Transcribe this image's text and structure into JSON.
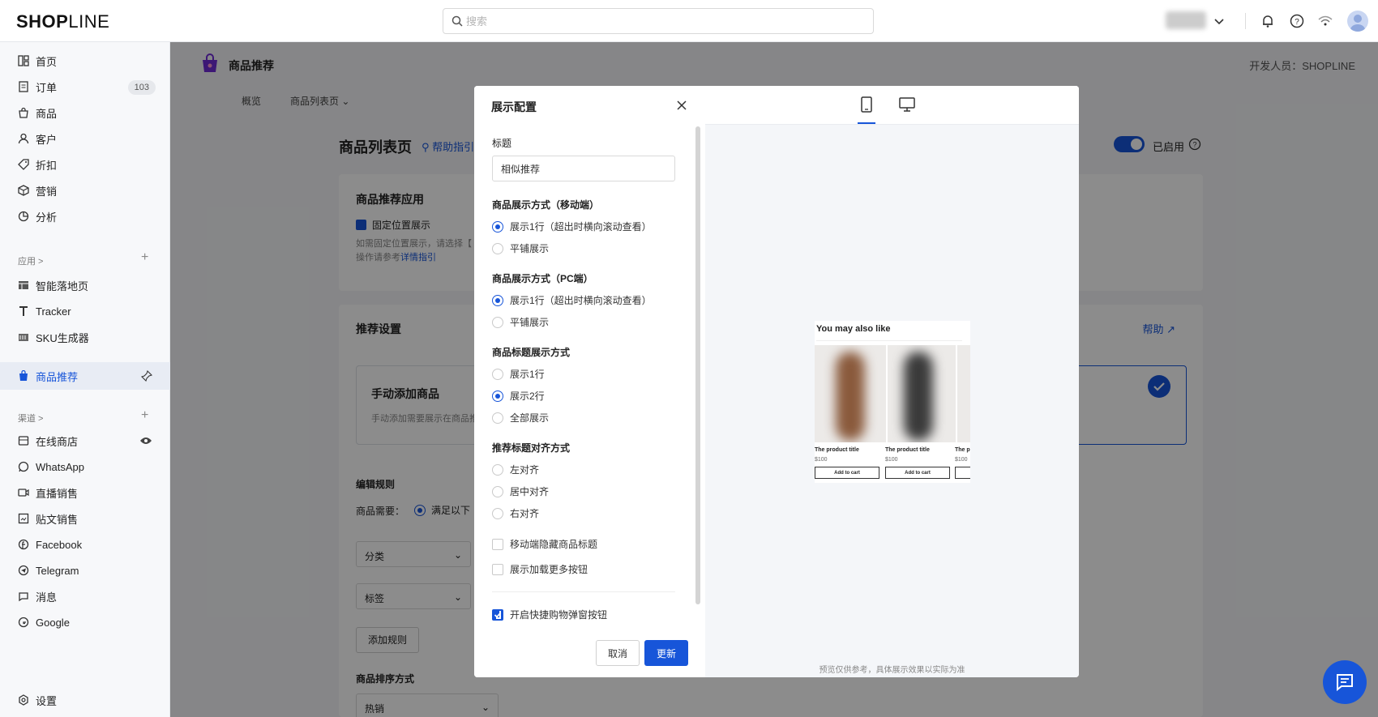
{
  "topbar": {
    "logo_bold": "SHOP",
    "logo_thin": "LINE",
    "search_placeholder": "搜索"
  },
  "sidebar": {
    "items": [
      {
        "label": "首页",
        "icon": "home-icon"
      },
      {
        "label": "订单",
        "icon": "orders-icon",
        "badge": "103"
      },
      {
        "label": "商品",
        "icon": "bag-icon"
      },
      {
        "label": "客户",
        "icon": "user-icon"
      },
      {
        "label": "折扣",
        "icon": "tag-icon"
      },
      {
        "label": "营销",
        "icon": "box-icon"
      },
      {
        "label": "分析",
        "icon": "chart-icon"
      }
    ],
    "apps_section": "应用 >",
    "apps": [
      {
        "label": "智能落地页",
        "icon": "layout-icon"
      },
      {
        "label": "Tracker",
        "icon": "tracker-icon"
      },
      {
        "label": "SKU生成器",
        "icon": "sku-icon"
      },
      {
        "label": "商品推荐",
        "icon": "recommend-icon",
        "active": true
      }
    ],
    "channels_section": "渠道 >",
    "channels": [
      {
        "label": "在线商店",
        "icon": "store-icon"
      },
      {
        "label": "WhatsApp",
        "icon": "whatsapp-icon"
      },
      {
        "label": "直播销售",
        "icon": "live-icon"
      },
      {
        "label": "贴文销售",
        "icon": "post-icon"
      },
      {
        "label": "Facebook",
        "icon": "facebook-icon"
      },
      {
        "label": "Telegram",
        "icon": "telegram-icon"
      },
      {
        "label": "消息",
        "icon": "message-icon"
      },
      {
        "label": "Google",
        "icon": "google-icon"
      }
    ],
    "settings": "设置"
  },
  "main": {
    "app_title": "商品推荐",
    "developer": "开发人员：SHOPLINE",
    "subnav_overview": "概览",
    "subnav_list": "商品列表页",
    "page_heading": "商品列表页",
    "help_guide": "帮助指引",
    "enabled": "已启用",
    "card1_title": "商品推荐应用",
    "card1_check": "固定位置展示",
    "card1_note1": "如需固定位置展示，请选择【",
    "card1_note2": "操作请参考",
    "card1_link": "详情指引",
    "card2_title": "推荐设置",
    "card2_help": "帮助",
    "manual_title": "手动添加商品",
    "manual_desc": "手动添加需要展示在商品推",
    "edit_rules": "编辑规则",
    "product_need": "商品需要：",
    "satisfy": "满足以下",
    "select_category": "分类",
    "select_tag": "标签",
    "add_rule": "添加规则",
    "sort_label": "商品排序方式",
    "sort_value": "热销"
  },
  "modal": {
    "title": "展示配置",
    "title_label": "标题",
    "title_value": "相似推荐",
    "mobile_label": "商品展示方式（移动端）",
    "mobile_opt1": "展示1行（超出时横向滚动查看）",
    "mobile_opt2": "平铺展示",
    "pc_label": "商品展示方式（PC端）",
    "pc_opt1": "展示1行（超出时横向滚动查看）",
    "pc_opt2": "平铺展示",
    "name_label": "商品标题展示方式",
    "name_opt1": "展示1行",
    "name_opt2": "展示2行",
    "name_opt3": "全部展示",
    "align_label": "推荐标题对齐方式",
    "align_opt1": "左对齐",
    "align_opt2": "居中对齐",
    "align_opt3": "右对齐",
    "hide_title": "移动端隐藏商品标题",
    "load_more": "展示加载更多按钮",
    "quick_cart": "开启快捷购物弹窗按钮",
    "cancel": "取消",
    "update": "更新"
  },
  "preview": {
    "heading": "You may also like",
    "products": [
      {
        "name": "The product title",
        "price": "$100",
        "button": "Add to cart"
      },
      {
        "name": "The product title",
        "price": "$100",
        "button": "Add to cart"
      },
      {
        "name": "The p",
        "price": "$100",
        "button": ""
      }
    ],
    "note": "预览仅供参考，具体展示效果以实际为准"
  },
  "colors": {
    "accent": "#1755d9",
    "overlay": "rgba(0,0,0,0.45)"
  }
}
